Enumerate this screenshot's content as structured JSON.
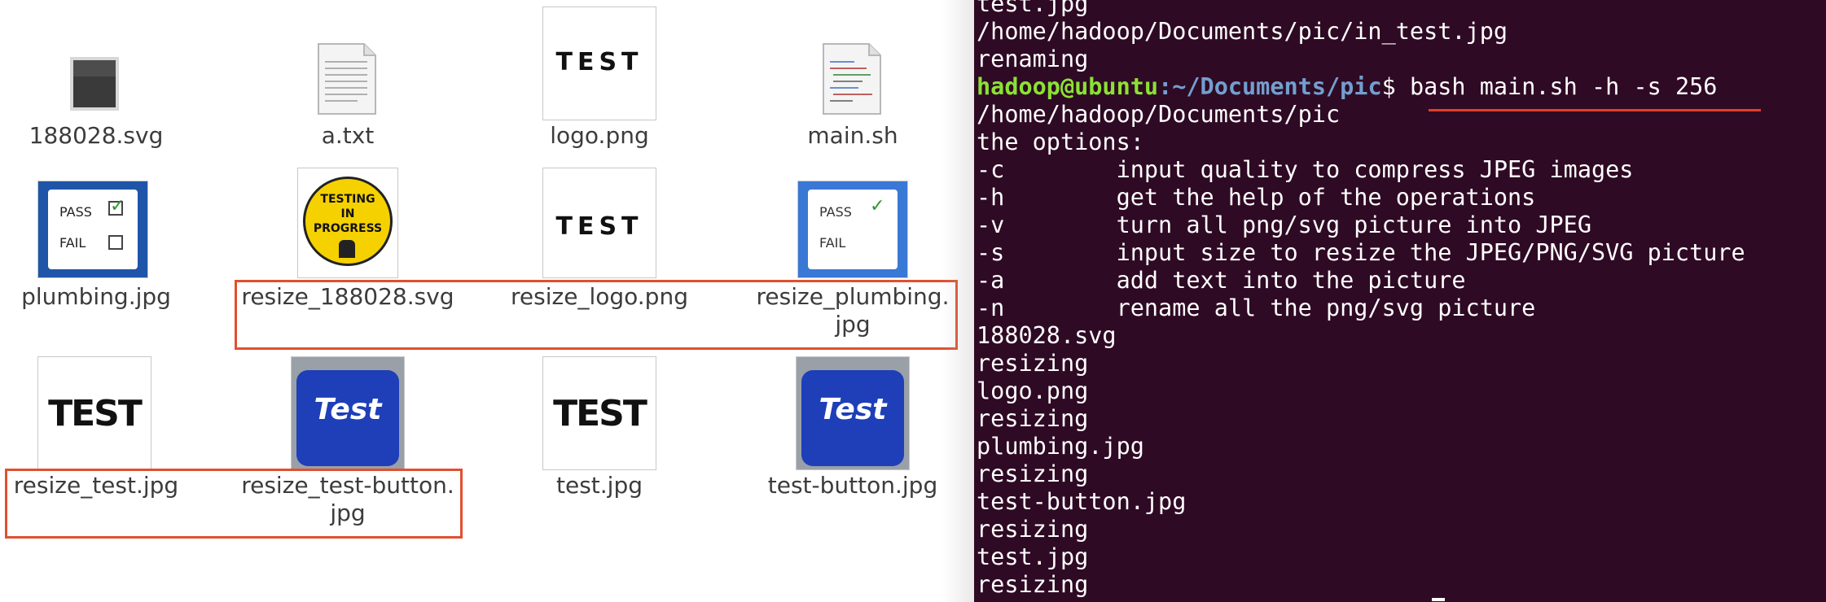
{
  "file_manager": {
    "files": [
      {
        "name": "188028.svg",
        "thumb": "dark-monitor"
      },
      {
        "name": "a.txt",
        "thumb": "text-doc"
      },
      {
        "name": "logo.png",
        "thumb": "test-text-logo"
      },
      {
        "name": "main.sh",
        "thumb": "script-doc"
      },
      {
        "name": "plumbing.jpg",
        "thumb": "pass-fail-sign"
      },
      {
        "name": "resize_188028.svg",
        "thumb": "testing-in-progress-sign"
      },
      {
        "name": "resize_logo.png",
        "thumb": "test-text-logo"
      },
      {
        "name": "resize_plumbing.\njpg",
        "thumb": "pass-fail-sign"
      },
      {
        "name": "resize_test.jpg",
        "thumb": "test-bold-text"
      },
      {
        "name": "resize_test-button.\njpg",
        "thumb": "blue-test-key"
      },
      {
        "name": "test.jpg",
        "thumb": "test-bold-text"
      },
      {
        "name": "test-button.jpg",
        "thumb": "blue-test-key"
      }
    ],
    "thumb_text": {
      "test": "TEST",
      "pass": "PASS",
      "fail": "FAIL",
      "testing_line1": "TESTING",
      "testing_line2": "IN",
      "testing_line3": "PROGRESS",
      "key": "Test"
    },
    "highlight_color": "#e0502f"
  },
  "terminal": {
    "background": "#2f0a24",
    "prompt_user": "hadoop@ubuntu",
    "prompt_path": ":~/Documents/pic",
    "prompt_symbol": "$ ",
    "command": "bash main.sh -h -s 256",
    "lines_before": [
      "test.jpg",
      "/home/hadoop/Documents/pic/in_test.jpg",
      "renaming"
    ],
    "lines_after": [
      "/home/hadoop/Documents/pic",
      "the options:",
      "-c        input quality to compress JPEG images",
      "-h        get the help of the operations",
      "-v        turn all png/svg picture into JPEG",
      "-s        input size to resize the JPEG/PNG/SVG picture",
      "-a        add text into the picture",
      "-n        rename all the png/svg picture",
      "188028.svg",
      "resizing",
      "logo.png",
      "resizing",
      "plumbing.jpg",
      "resizing",
      "test-button.jpg",
      "resizing",
      "test.jpg",
      "resizing"
    ]
  }
}
